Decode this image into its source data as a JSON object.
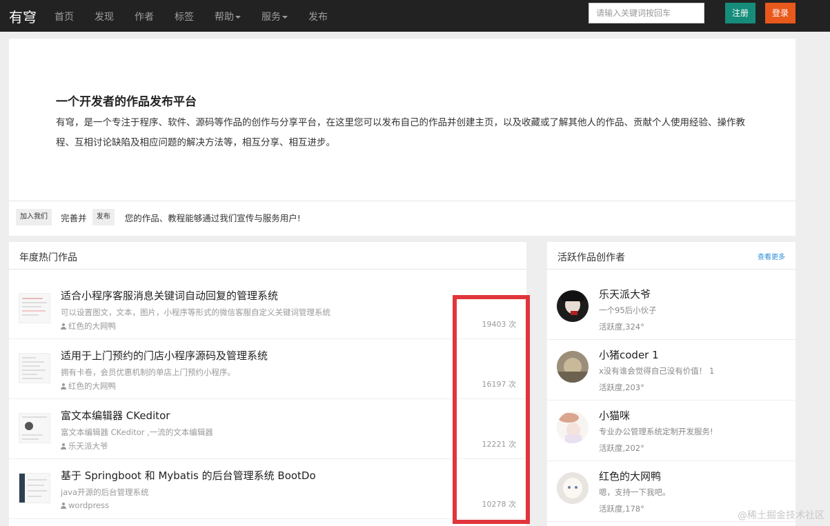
{
  "navbar": {
    "brand": "有穹",
    "items": [
      {
        "label": "首页"
      },
      {
        "label": "发现"
      },
      {
        "label": "作者"
      },
      {
        "label": "标签"
      },
      {
        "label": "帮助"
      },
      {
        "label": "服务"
      },
      {
        "label": "发布"
      }
    ],
    "search_placeholder": "请输入关键词按回车",
    "register_label": "注册",
    "login_label": "登录"
  },
  "hero": {
    "title": "一个开发者的作品发布平台",
    "description": "有穹，是一个专注于程序、软件、源码等作品的创作与分享平台，在这里您可以发布自己的作品并创建主页，以及收藏或了解其他人的作品、贡献个人使用经验、操作教程、互相讨论缺陷及相应问题的解决方法等，相互分享、相互进步。",
    "join_label": "加入我们",
    "join_text_1": "完善并",
    "publish_label": "发布",
    "join_text_2": "您的作品、教程能够通过我们宣传与服务用户!"
  },
  "hot_works": {
    "title": "年度热门作品",
    "items": [
      {
        "title": "适合小程序客服消息关键词自动回复的管理系统",
        "desc": "可以设置图文，文本，图片，小程序等形式的微信客服自定义关键词管理系统",
        "author": "红色的大网鸭",
        "count": "19403 次"
      },
      {
        "title": "适用于上门预约的门店小程序源码及管理系统",
        "desc": "拥有卡卷，会员优惠机制的单店上门预约小程序。",
        "author": "红色的大网鸭",
        "count": "16197 次"
      },
      {
        "title": "富文本编辑器 CKeditor",
        "desc": "富文本编辑器 CKeditor ,一流的文本编辑器",
        "author": "乐天派大爷",
        "count": "12221 次"
      },
      {
        "title": "基于 Springboot 和 Mybatis 的后台管理系统 BootDo",
        "desc": "java开源的后台管理系统",
        "author": "wordpress",
        "count": "10278 次"
      }
    ]
  },
  "active_authors": {
    "title": "活跃作品创作者",
    "more_label": "查看更多",
    "items": [
      {
        "name": "乐天派大爷",
        "bio": "一个95后小伙子",
        "activity": "活跃度,324°"
      },
      {
        "name": "小猪coder 1",
        "bio": "x没有谁会觉得自己没有价值！ 1",
        "activity": "活跃度,203°"
      },
      {
        "name": "小猫咪",
        "bio": "专业办公管理系统定制开发服务!",
        "activity": "活跃度,202°"
      },
      {
        "name": "红色的大网鸭",
        "bio": "嗯，支持一下我吧。",
        "activity": "活跃度,178°"
      }
    ]
  },
  "watermark": "@稀土掘金技术社区",
  "colors": {
    "navbar_bg": "#222222",
    "register_green": "#168d7b",
    "login_orange": "#e9591c",
    "highlight_red": "#e0353b",
    "link_blue": "#2a8fd8"
  }
}
